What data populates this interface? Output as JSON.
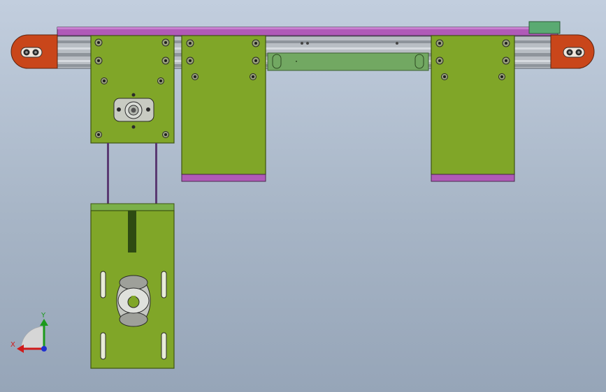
{
  "viewport": {
    "name": "cad-graphics-area",
    "background_top": "#c2cede",
    "background_bottom": "#96a5b8"
  },
  "colors": {
    "plate_green": "#80a628",
    "plate_green_dark": "#5f7d1a",
    "belt_purple": "#b05ab8",
    "rail_gray": "#b9bec4",
    "pulley_orange": "#c9461a",
    "slot_dark": "#2e4a12",
    "guide_bar": "#72a862",
    "axis_x": "#d01a1a",
    "axis_y": "#1c9a1c",
    "axis_z": "#2030d0"
  },
  "assembly": {
    "top_belt": "belt",
    "left_end_pulley": "pulley",
    "right_end_pulley": "pulley",
    "carriage_plates": [
      "left-carriage",
      "middle-carriage",
      "right-carriage"
    ],
    "motor_mount": "motor-mount-plate",
    "guide_bar": "linear-guide-bar"
  },
  "triad": {
    "x_label": "X",
    "y_label": "Y"
  }
}
